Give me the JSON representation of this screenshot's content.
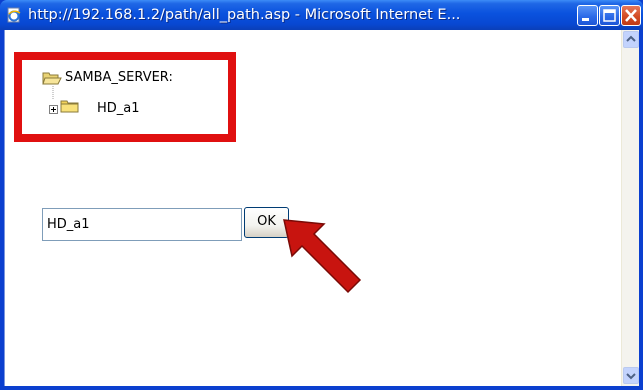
{
  "window": {
    "title": "http://192.168.1.2/path/all_path.asp - Microsoft Internet E...",
    "controls": [
      "minimize",
      "maximize",
      "close"
    ]
  },
  "tree": {
    "root_label": "SAMBA_SERVER:",
    "children": [
      {
        "label": "HD_a1",
        "expander": "plus"
      }
    ]
  },
  "path_input": {
    "value": "HD_a1"
  },
  "ok_button": {
    "label": "OK"
  },
  "annotations": {
    "highlight_color": "#e01010",
    "arrow_color": "#c8140f"
  },
  "icons": {
    "title": "ie-page-icon",
    "root": "open-folder-icon",
    "child": "folder-icon"
  }
}
